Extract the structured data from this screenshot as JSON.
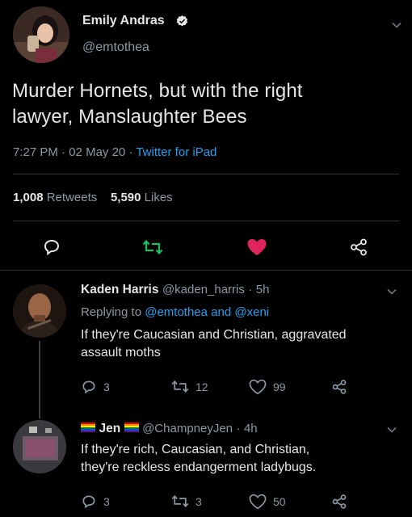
{
  "tweet": {
    "author_name": "Emily Andras",
    "author_handle": "@emtothea",
    "text_line1": "Murder Hornets, but with the right",
    "text_line2": "lawyer, Manslaughter Bees",
    "time": "7:27 PM",
    "date": "02 May 20",
    "source": "Twitter for iPad",
    "retweets_count": "1,008",
    "retweets_label": "Retweets",
    "likes_count": "5,590",
    "likes_label": "Likes"
  },
  "replies": [
    {
      "name": "Kaden Harris",
      "handle": "@kaden_harris",
      "age": "5h",
      "replying_prefix": "Replying to",
      "replying_user1": "@emtothea",
      "replying_and": "and",
      "replying_user2": "@xeni",
      "text_line1": "If they're Caucasian and Christian, aggravated",
      "text_line2": "assault moths",
      "replies": "3",
      "retweets": "12",
      "likes": "99"
    },
    {
      "name": "Jen",
      "handle": "@ChampneyJen",
      "age": "4h",
      "text_line1": "If they're rich, Caucasian, and Christian,",
      "text_line2": "they're reckless endangerment ladybugs.",
      "replies": "3",
      "retweets": "3",
      "likes": "50"
    }
  ],
  "colors": {
    "background": "#000000",
    "accent": "#1da1f2",
    "retweet_green": "#17bf63",
    "like_red": "#e0245e",
    "muted": "#8b98a5"
  },
  "icons": [
    "verified-badge-icon",
    "chevron-down-icon",
    "reply-icon",
    "retweet-icon",
    "like-heart-icon",
    "share-icon"
  ]
}
